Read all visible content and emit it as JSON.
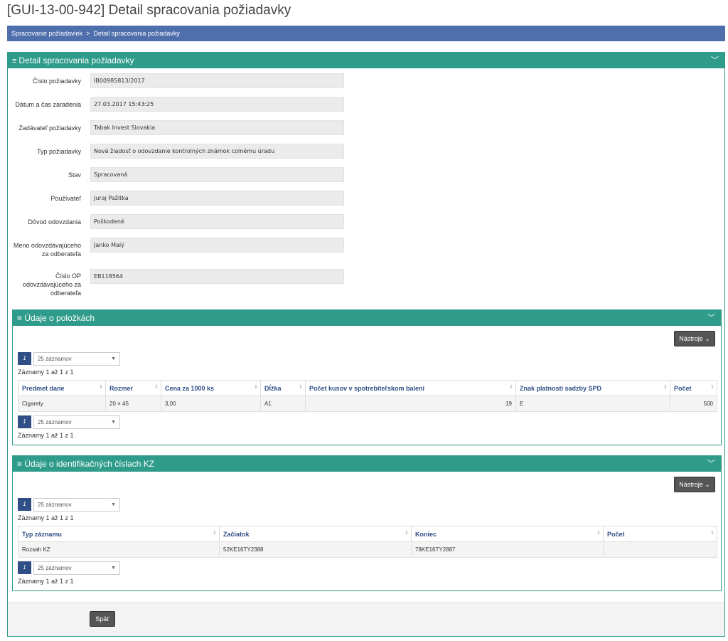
{
  "page_title": "[GUI-13-00-942] Detail spracovania požiadavky",
  "breadcrumb": {
    "items": [
      "Spracovanie požiadaviek",
      "Detail spracovania požiadavky"
    ],
    "separator": ">"
  },
  "main_panel": {
    "title": "Detail spracovania požiadavky",
    "fields": [
      {
        "label": "Číslo požiadavky",
        "value": "IB00985813/2017"
      },
      {
        "label": "Dátum a čas zaradenia",
        "value": "27.03.2017 15:43:25"
      },
      {
        "label": "Zadávateľ požiadavky",
        "value": "Tabak Invest Slovakia"
      },
      {
        "label": "Typ požiadavky",
        "value": "Nová žiadosť o odovzdanie kontrolných známok colnému úradu"
      },
      {
        "label": "Stav",
        "value": "Spracovaná"
      },
      {
        "label": "Používateľ",
        "value": "Juraj Pažitka"
      },
      {
        "label": "Dôvod odovzdania",
        "value": "Poškodené"
      },
      {
        "label": "Meno odovzdávajúceho za odberateľa",
        "value": "Janko Malý"
      },
      {
        "label": "Číslo OP odovzdávajúceho za odberateľa",
        "value": "EB118564"
      }
    ]
  },
  "items_panel": {
    "title": "Údaje o položkách",
    "tools_label": "Nástroje",
    "pager": {
      "page": "1",
      "page_size": "25 záznamov"
    },
    "records_info": "Záznamy 1 až 1 z 1",
    "columns": [
      "Predmet dane",
      "Rozmer",
      "Cena za 1000 ks",
      "Dĺžka",
      "Počet kusov v spotrebiteľskom balení",
      "Znak platnosti sadzby SPD",
      "Počet"
    ],
    "rows": [
      [
        "Cigarety",
        "20 × 45",
        "3,00",
        "A1",
        "19",
        "E",
        "500"
      ]
    ]
  },
  "kz_panel": {
    "title": "Údaje o identifikačných číslach KZ",
    "tools_label": "Nástroje",
    "pager": {
      "page": "1",
      "page_size": "25 záznamov"
    },
    "records_info": "Záznamy 1 až 1 z 1",
    "columns": [
      "Typ záznamu",
      "Začiatok",
      "Koniec",
      "Počet"
    ],
    "rows": [
      [
        "Rozsah KZ",
        "52KE16TY2388",
        "78KE16TY2887",
        ""
      ]
    ]
  },
  "footer": {
    "back_label": "Späť"
  },
  "colors": {
    "accent_teal": "#2f9b8a",
    "breadcrumb_blue": "#4e6fac",
    "pager_blue": "#2f4f86",
    "button_dark": "#555555"
  },
  "icons": {
    "panel_menu": "bars-icon",
    "panel_collapse": "chevron-down-icon",
    "sort": "sort-icon",
    "dropdown": "caret-down-icon"
  }
}
